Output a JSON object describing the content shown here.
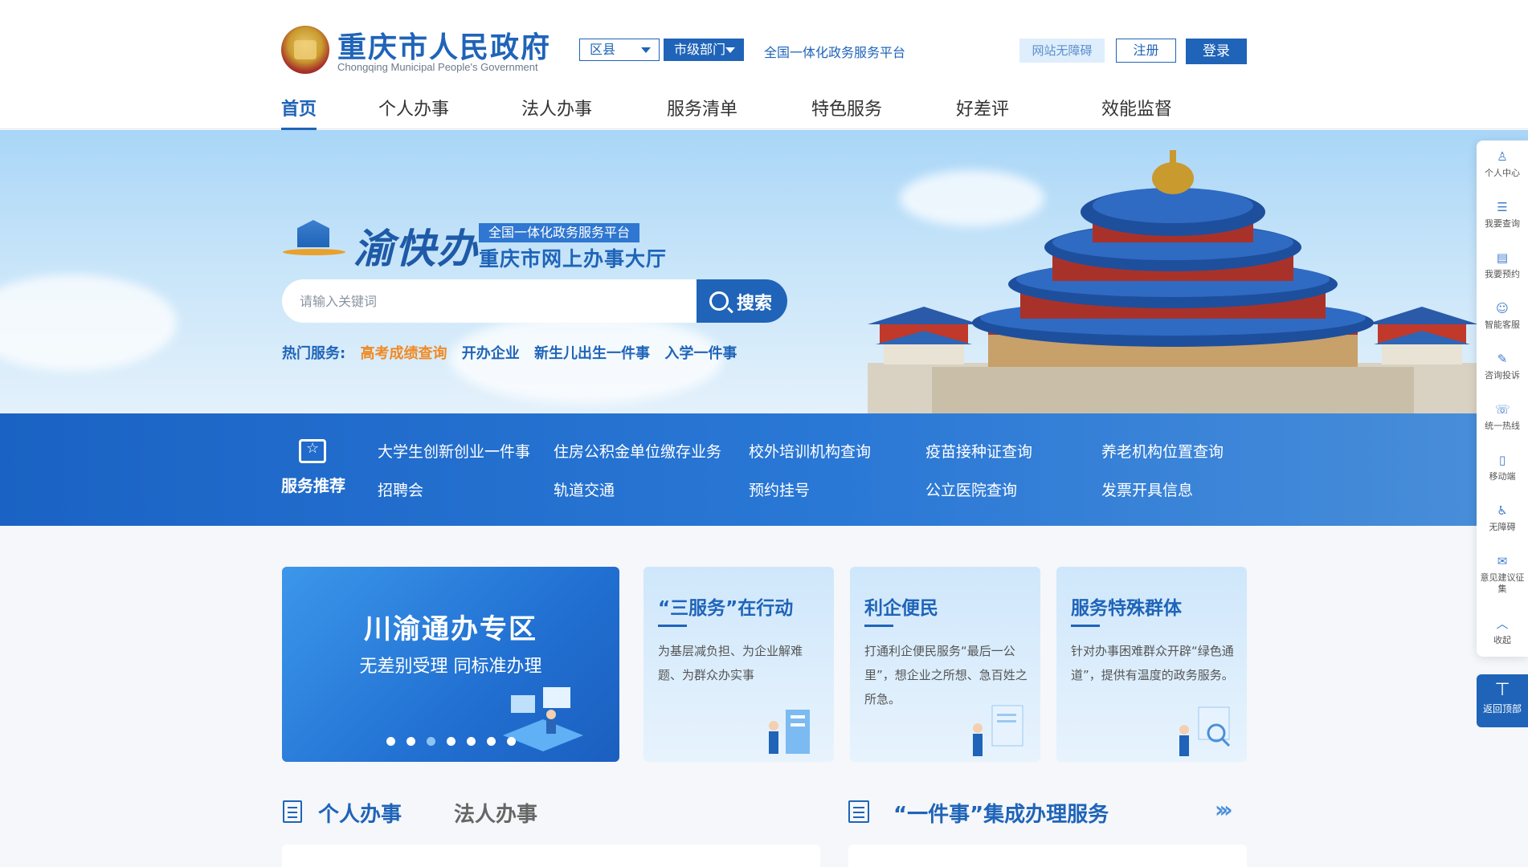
{
  "header": {
    "title": "重庆市人民政府",
    "subtitle": "Chongqing Municipal People's Government",
    "region_select": "区县",
    "dept_select": "市级部门",
    "platform_link": "全国一体化政务服务平台",
    "accessibility": "网站无障碍",
    "register": "注册",
    "login": "登录"
  },
  "nav": [
    "首页",
    "个人办事",
    "法人办事",
    "服务清单",
    "特色服务",
    "好差评",
    "效能监督"
  ],
  "banner": {
    "brand": "渝快办",
    "tag": "全国一体化政务服务平台",
    "hall": "重庆市网上办事大厅",
    "search_placeholder": "请输入关键词",
    "search_button": "搜索",
    "hot_label": "热门服务:",
    "hot_items": [
      "高考成绩查询",
      "开办企业",
      "新生儿出生一件事",
      "入学一件事"
    ]
  },
  "recommend": {
    "title": "服务推荐",
    "row1": [
      "大学生创新创业一件事",
      "住房公积金单位缴存业务",
      "校外培训机构查询",
      "疫苗接种证查询",
      "养老机构位置查询"
    ],
    "row2": [
      "招聘会",
      "轨道交通",
      "预约挂号",
      "公立医院查询",
      "发票开具信息"
    ]
  },
  "feature_main": {
    "title": "川渝通办专区",
    "subtitle": "无差别受理 同标准办理",
    "dot_count": 7,
    "active_dot": 3
  },
  "cards": [
    {
      "title": "“三服务”在行动",
      "desc": "为基层减负担、为企业解难题、为群众办实事"
    },
    {
      "title": "利企便民",
      "desc": "打通利企便民服务“最后一公里”，想企业之所想、急百姓之所急。"
    },
    {
      "title": "服务特殊群体",
      "desc": "针对办事困难群众开辟“绿色通道”，提供有温度的政务服务。"
    }
  ],
  "bottom": {
    "tab_personal": "个人办事",
    "tab_legal": "法人办事",
    "integrated_title": "“一件事”集成办理服务"
  },
  "sidebar": [
    {
      "icon": "user-icon",
      "label": "个人中心"
    },
    {
      "icon": "query-icon",
      "label": "我要查询"
    },
    {
      "icon": "calendar-icon",
      "label": "我要预约"
    },
    {
      "icon": "customer-service-icon",
      "label": "智能客服"
    },
    {
      "icon": "edit-icon",
      "label": "咨询投诉"
    },
    {
      "icon": "phone-icon",
      "label": "统一热线"
    },
    {
      "icon": "mobile-icon",
      "label": "移动端"
    },
    {
      "icon": "wheelchair-icon",
      "label": "无障碍"
    },
    {
      "icon": "feedback-icon",
      "label": "意见建议征集"
    },
    {
      "icon": "chevron-up-icon",
      "label": "收起"
    }
  ],
  "back_top": "返回顶部",
  "colors": {
    "primary": "#1f64b8",
    "highlight": "#f08a24",
    "banner_sky": "#a9d6f7"
  }
}
